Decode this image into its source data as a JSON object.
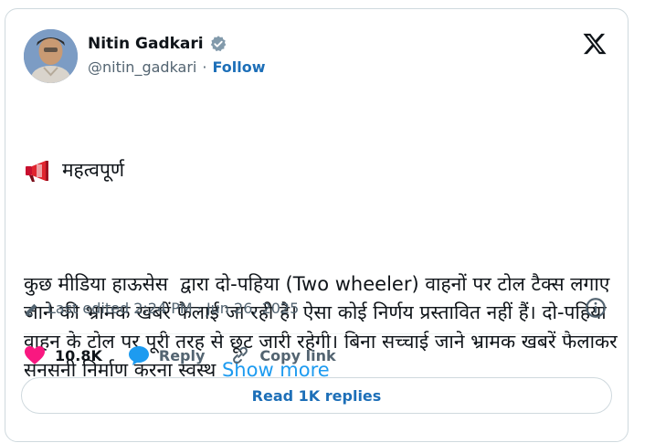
{
  "author": {
    "name": "Nitin Gadkari",
    "handle": "@nitin_gadkari",
    "separator": "·",
    "follow_label": "Follow"
  },
  "tweet": {
    "heading": "महत्वपूर्ण",
    "body": "कुछ मीडिया हाऊसेस  द्वारा दो-पहिया (Two wheeler) वाहनों पर टोल टैक्स लगाए जाने की भ्रामक खबरें फैलाई जा रही है। ऐसा कोई निर्णय प्रस्तावित नहीं हैं। दो-पहिया वाहन के टोल पर पूरी तरह से छूट जारी रहेगी। बिना सच्चाई जाने भ्रामक खबरें फैलाकर सनसनी निर्माण करना स्वस्थ",
    "show_more": "Show more",
    "edited": "Last edited 2:24 PM · Jun 26, 2025"
  },
  "actions": {
    "likes": "10.8K",
    "reply": "Reply",
    "copy_link": "Copy link"
  },
  "read_replies": "Read 1K replies",
  "colors": {
    "like": "#f91880",
    "link": "#1d9bf0",
    "button_text": "#1d6fb8",
    "verified": "#829aab"
  }
}
